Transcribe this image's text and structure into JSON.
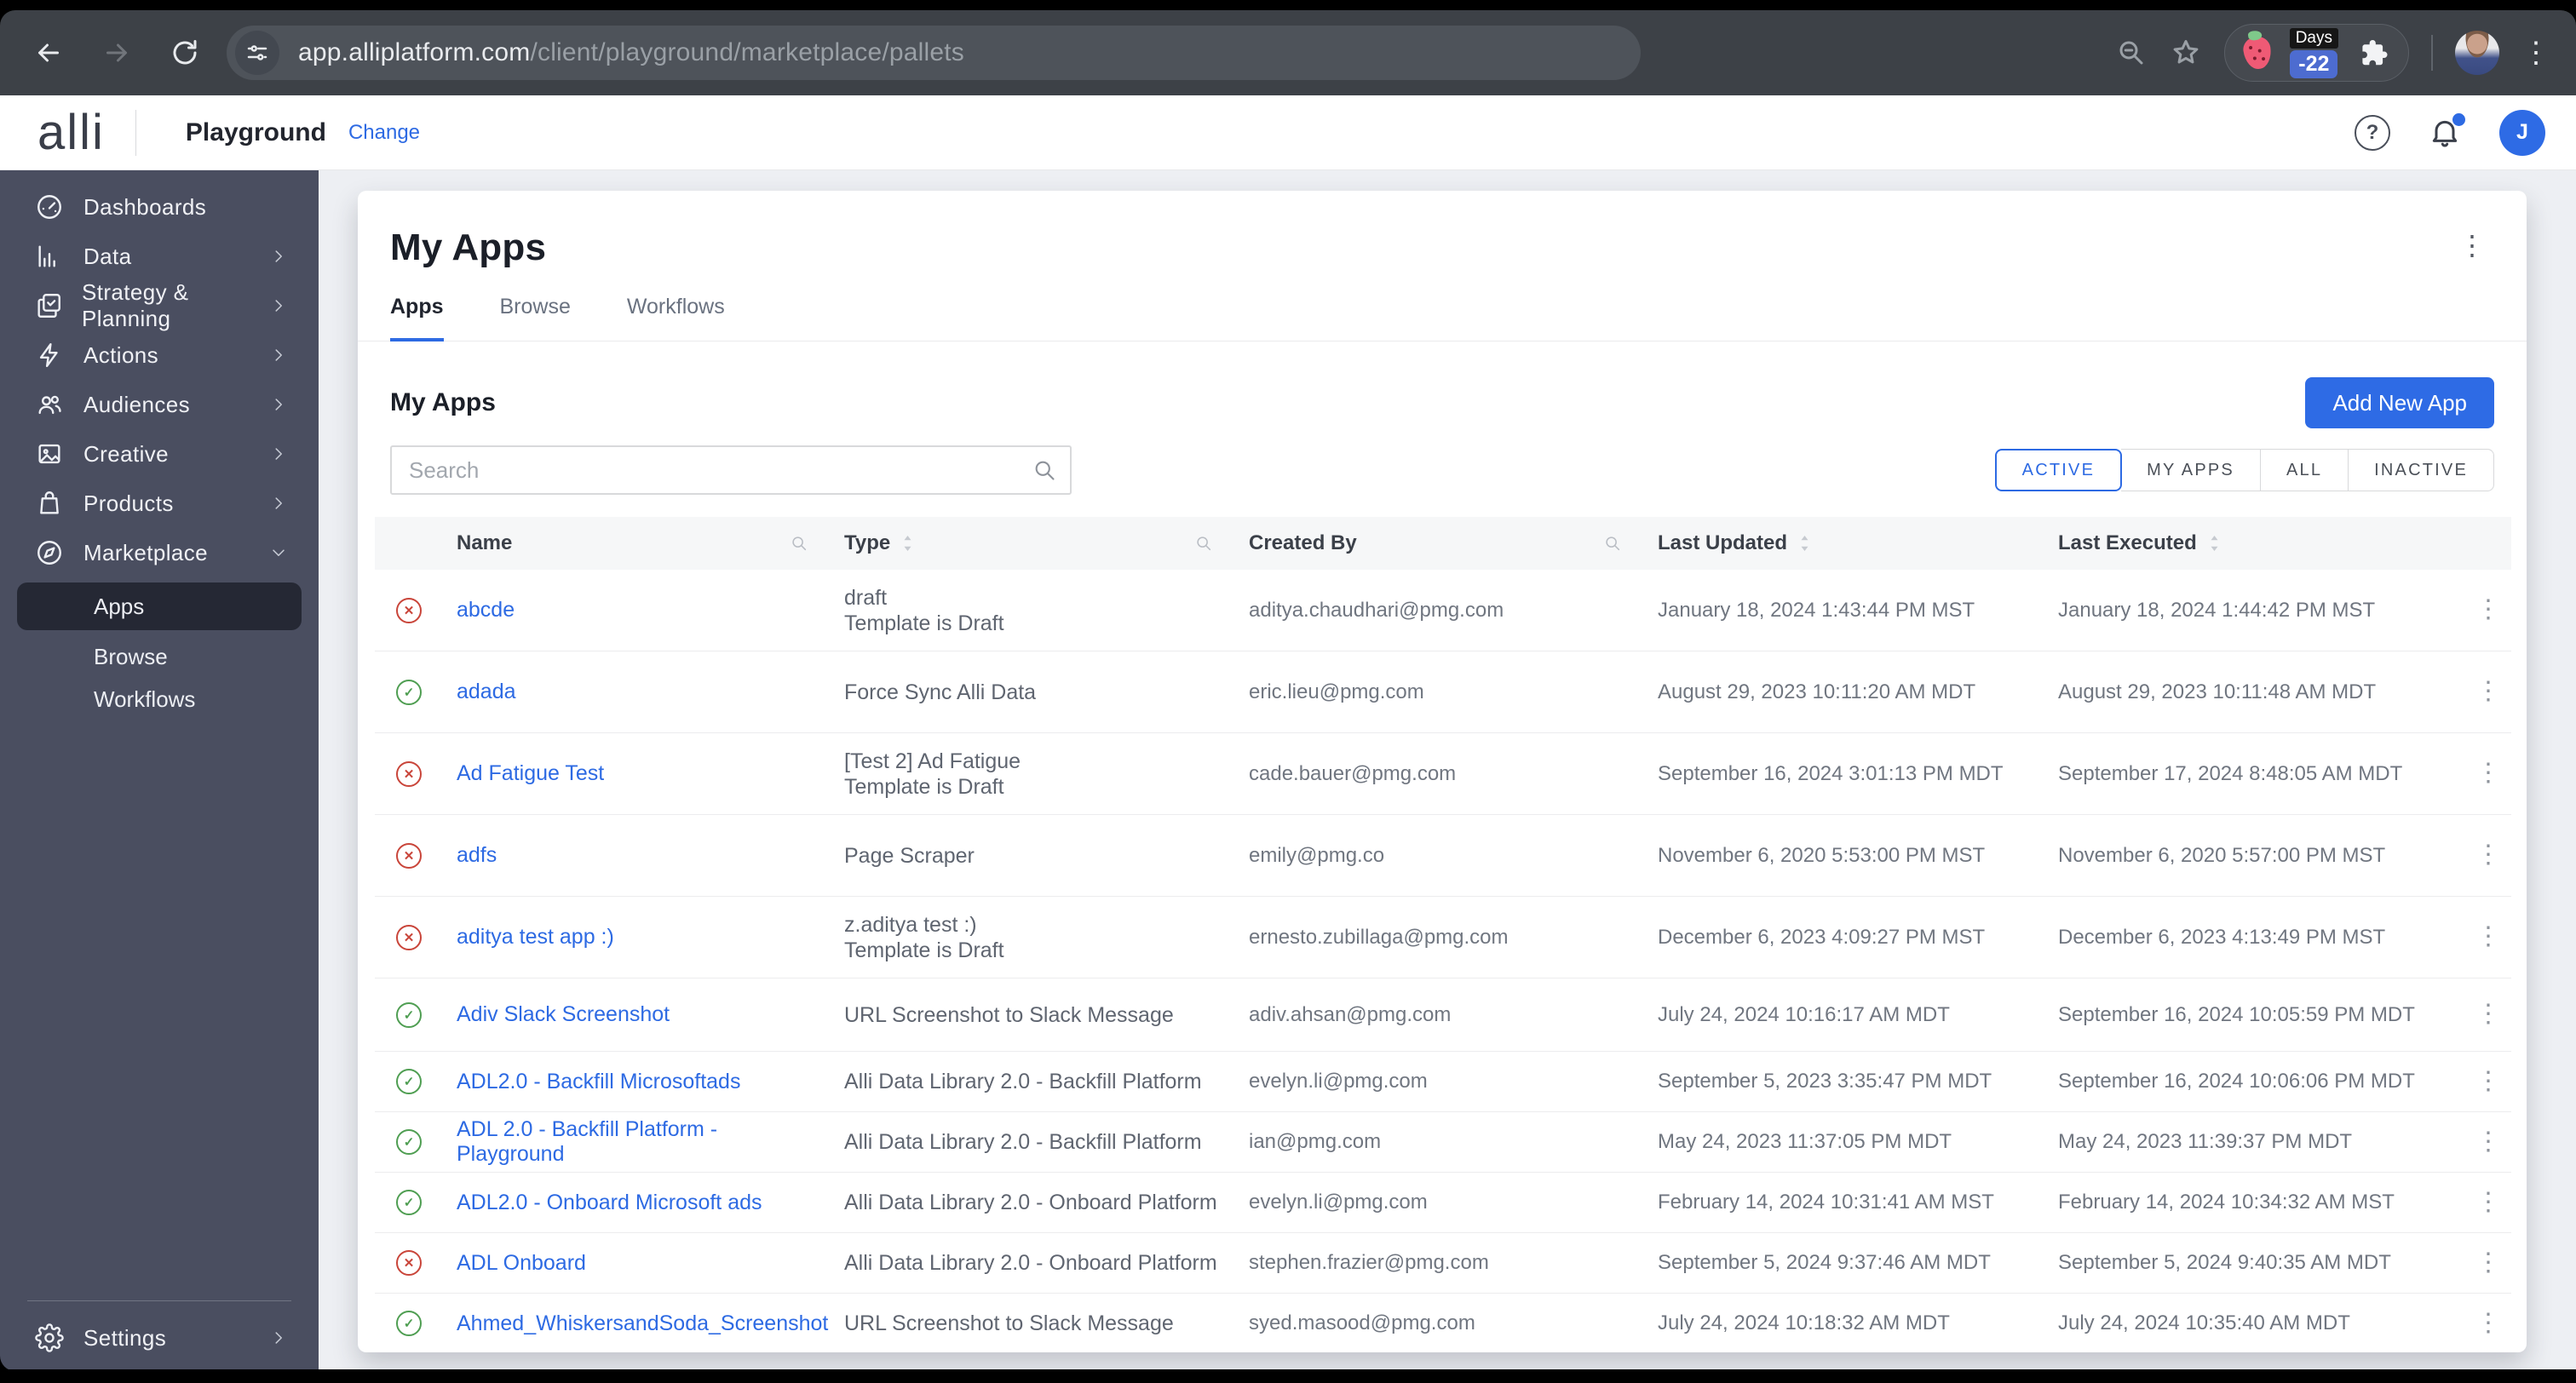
{
  "colors": {
    "accent_blue": "#2d6ae3",
    "button_blue": "#2e6be5",
    "status_ok": "#4f9e52",
    "status_error": "#c9453a",
    "sidebar_bg": "#4a4e60",
    "sidebar_active_bg": "#252834"
  },
  "browser": {
    "url_host": "app.alliplatform.com",
    "url_path": "/client/playground/marketplace/pallets",
    "extension": {
      "days_label": "Days",
      "days_value": "-22"
    },
    "menu_dots": "⋮"
  },
  "app_header": {
    "logo": "alli",
    "client_name": "Playground",
    "change_link": "Change",
    "help_glyph": "?",
    "avatar_initial": "J"
  },
  "sidebar": {
    "items": [
      {
        "label": "Dashboards",
        "icon": "gauge",
        "chevron": "none"
      },
      {
        "label": "Data",
        "icon": "bar-chart",
        "chevron": "right"
      },
      {
        "label": "Strategy & Planning",
        "icon": "clipboard",
        "chevron": "right"
      },
      {
        "label": "Actions",
        "icon": "lightning",
        "chevron": "right"
      },
      {
        "label": "Audiences",
        "icon": "people",
        "chevron": "right"
      },
      {
        "label": "Creative",
        "icon": "image",
        "chevron": "right"
      },
      {
        "label": "Products",
        "icon": "bag",
        "chevron": "right"
      },
      {
        "label": "Marketplace",
        "icon": "compass",
        "chevron": "down"
      }
    ],
    "marketplace_children": [
      {
        "label": "Apps",
        "active": true
      },
      {
        "label": "Browse",
        "active": false
      },
      {
        "label": "Workflows",
        "active": false
      }
    ],
    "settings": {
      "label": "Settings",
      "icon": "gear",
      "chevron": "right"
    }
  },
  "main": {
    "page_title": "My Apps",
    "card_menu_dots": "⋮",
    "tabs": [
      {
        "label": "Apps",
        "active": true
      },
      {
        "label": "Browse",
        "active": false
      },
      {
        "label": "Workflows",
        "active": false
      }
    ],
    "section_title": "My Apps",
    "add_button": "Add New App",
    "search_placeholder": "Search",
    "filters": [
      {
        "label": "ACTIVE",
        "active": true
      },
      {
        "label": "MY APPS",
        "active": false
      },
      {
        "label": "ALL",
        "active": false
      },
      {
        "label": "INACTIVE",
        "active": false
      }
    ],
    "table": {
      "columns": [
        {
          "label": "Name",
          "search": true,
          "sort": false
        },
        {
          "label": "Type",
          "search": true,
          "sort": true
        },
        {
          "label": "Created By",
          "search": true,
          "sort": false
        },
        {
          "label": "Last Updated",
          "search": false,
          "sort": true
        },
        {
          "label": "Last Executed",
          "search": false,
          "sort": true
        }
      ],
      "rows": [
        {
          "status": "error",
          "name": "abcde",
          "type_lines": [
            "draft",
            "Template is Draft"
          ],
          "created_by": "aditya.chaudhari@pmg.com",
          "last_updated": "January 18, 2024 1:43:44 PM MST",
          "last_executed": "January 18, 2024 1:44:42 PM MST"
        },
        {
          "status": "ok",
          "name": "adada",
          "type_lines": [
            "Force Sync Alli Data"
          ],
          "created_by": "eric.lieu@pmg.com",
          "last_updated": "August 29, 2023 10:11:20 AM MDT",
          "last_executed": "August 29, 2023 10:11:48 AM MDT"
        },
        {
          "status": "error",
          "name": "Ad Fatigue Test",
          "type_lines": [
            "[Test 2] Ad Fatigue",
            "Template is Draft"
          ],
          "created_by": "cade.bauer@pmg.com",
          "last_updated": "September 16, 2024 3:01:13 PM MDT",
          "last_executed": "September 17, 2024 8:48:05 AM MDT"
        },
        {
          "status": "error",
          "name": "adfs",
          "type_lines": [
            "Page Scraper"
          ],
          "created_by": "emily@pmg.co",
          "last_updated": "November 6, 2020 5:53:00 PM MST",
          "last_executed": "November 6, 2020 5:57:00 PM MST"
        },
        {
          "status": "error",
          "name": "aditya test app :)",
          "type_lines": [
            "z.aditya test :)",
            "Template is Draft"
          ],
          "created_by": "ernesto.zubillaga@pmg.com",
          "last_updated": "December 6, 2023 4:09:27 PM MST",
          "last_executed": "December 6, 2023 4:13:49 PM MST"
        },
        {
          "status": "ok",
          "name": "Adiv Slack Screenshot",
          "type_lines": [
            "URL Screenshot to Slack Message"
          ],
          "created_by": "adiv.ahsan@pmg.com",
          "last_updated": "July 24, 2024 10:16:17 AM MDT",
          "last_executed": "September 16, 2024 10:05:59 PM MDT"
        },
        {
          "status": "ok",
          "name": "ADL2.0 - Backfill Microsoftads",
          "type_lines": [
            "Alli Data Library 2.0 - Backfill Platform"
          ],
          "created_by": "evelyn.li@pmg.com",
          "last_updated": "September 5, 2023 3:35:47 PM MDT",
          "last_executed": "September 16, 2024 10:06:06 PM MDT"
        },
        {
          "status": "ok",
          "name": "ADL 2.0 - Backfill Platform - Playground",
          "type_lines": [
            "Alli Data Library 2.0 - Backfill Platform"
          ],
          "created_by": "ian@pmg.com",
          "last_updated": "May 24, 2023 11:37:05 PM MDT",
          "last_executed": "May 24, 2023 11:39:37 PM MDT"
        },
        {
          "status": "ok",
          "name": "ADL2.0 - Onboard Microsoft ads",
          "type_lines": [
            "Alli Data Library 2.0 - Onboard Platform"
          ],
          "created_by": "evelyn.li@pmg.com",
          "last_updated": "February 14, 2024 10:31:41 AM MST",
          "last_executed": "February 14, 2024 10:34:32 AM MST"
        },
        {
          "status": "error",
          "name": "ADL Onboard",
          "type_lines": [
            "Alli Data Library 2.0 - Onboard Platform"
          ],
          "created_by": "stephen.frazier@pmg.com",
          "last_updated": "September 5, 2024 9:37:46 AM MDT",
          "last_executed": "September 5, 2024 9:40:35 AM MDT"
        },
        {
          "status": "ok",
          "name": "Ahmed_WhiskersandSoda_Screenshot",
          "type_lines": [
            "URL Screenshot to Slack Message"
          ],
          "created_by": "syed.masood@pmg.com",
          "last_updated": "July 24, 2024 10:18:32 AM MDT",
          "last_executed": "July 24, 2024 10:35:40 AM MDT"
        }
      ]
    }
  }
}
